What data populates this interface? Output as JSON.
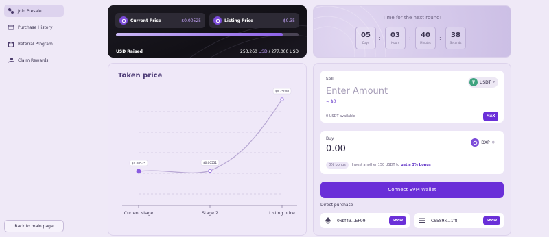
{
  "sidebar": {
    "items": [
      {
        "label": "Join Presale",
        "icon": "presale-icon",
        "active": true
      },
      {
        "label": "Purchase History",
        "icon": "history-icon",
        "active": false
      },
      {
        "label": "Referral Program",
        "icon": "gift-icon",
        "active": false
      },
      {
        "label": "Claim Rewards",
        "icon": "claim-icon",
        "active": false
      }
    ],
    "back_label": "Back to main page"
  },
  "price_card": {
    "current_label": "Current Price",
    "current_value": "$0.00525",
    "listing_label": "Listing Price",
    "listing_value": "$0.35",
    "progress_fraction": 0.915,
    "raised_label": "USD Raised",
    "raised_amount": "253,260",
    "raised_currency": "USD",
    "raised_total": "/ 277,000 USD"
  },
  "countdown": {
    "title": "Time for the next round!",
    "units": [
      {
        "value": "05",
        "unit": "Days"
      },
      {
        "value": "03",
        "unit": "Hours"
      },
      {
        "value": "40",
        "unit": "Minutes"
      },
      {
        "value": "38",
        "unit": "Seconds"
      }
    ]
  },
  "chart": {
    "title": "Token price"
  },
  "chart_data": {
    "type": "line",
    "title": "Token price",
    "categories": [
      "Current stage",
      "Stage 2",
      "Listing price"
    ],
    "values": [
      0.00525,
      0.00551,
      0.35
    ],
    "point_labels": [
      "$0.00525",
      "$0.00551",
      "$0.35000"
    ],
    "grid": true
  },
  "swap": {
    "sell_label": "Sell",
    "sell_placeholder": "Enter Amount",
    "sell_usd": "≈ $0",
    "sell_token": "USDT",
    "available": "0 USDT available",
    "max_label": "MAX",
    "buy_label": "Buy",
    "buy_value": "0.00",
    "buy_token": "DXP",
    "bonus_badge": "0% bonus",
    "bonus_text": "Invest another 150 USDT to",
    "bonus_cta": "get a 3% bonus",
    "connect_label": "Connect EVM Wallet",
    "direct_label": "Direct purchase",
    "addresses": [
      {
        "icon": "ethereum-icon",
        "address": "0xbf43...EF99",
        "button": "Show"
      },
      {
        "icon": "solana-icon",
        "address": "CS589x...1f8j",
        "button": "Show"
      }
    ]
  },
  "colors": {
    "accent": "#6a2fd8",
    "background": "#efe9f7",
    "dark_card": "#141218",
    "tether": "#3fa37f"
  }
}
